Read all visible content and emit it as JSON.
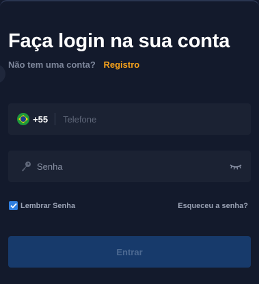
{
  "header": {
    "title": "Faça login na sua conta",
    "no_account_text": "Não tem uma conta?",
    "register_link": "Registro"
  },
  "phone": {
    "flag_icon": "brazil-flag-icon",
    "dial_code": "+55",
    "placeholder": "Telefone",
    "value": ""
  },
  "password": {
    "icon": "key-icon",
    "placeholder": "Senha",
    "value": "",
    "toggle_icon": "eye-closed-icon"
  },
  "options": {
    "remember_label": "Lembrar Senha",
    "remember_checked": true,
    "forgot_link": "Esqueceu a senha?"
  },
  "submit": {
    "label": "Entrar"
  },
  "colors": {
    "background": "#131a2c",
    "field": "#1b2233",
    "accent": "#f7a21b",
    "checkbox": "#2f7fe0",
    "button": "#173a6b"
  }
}
